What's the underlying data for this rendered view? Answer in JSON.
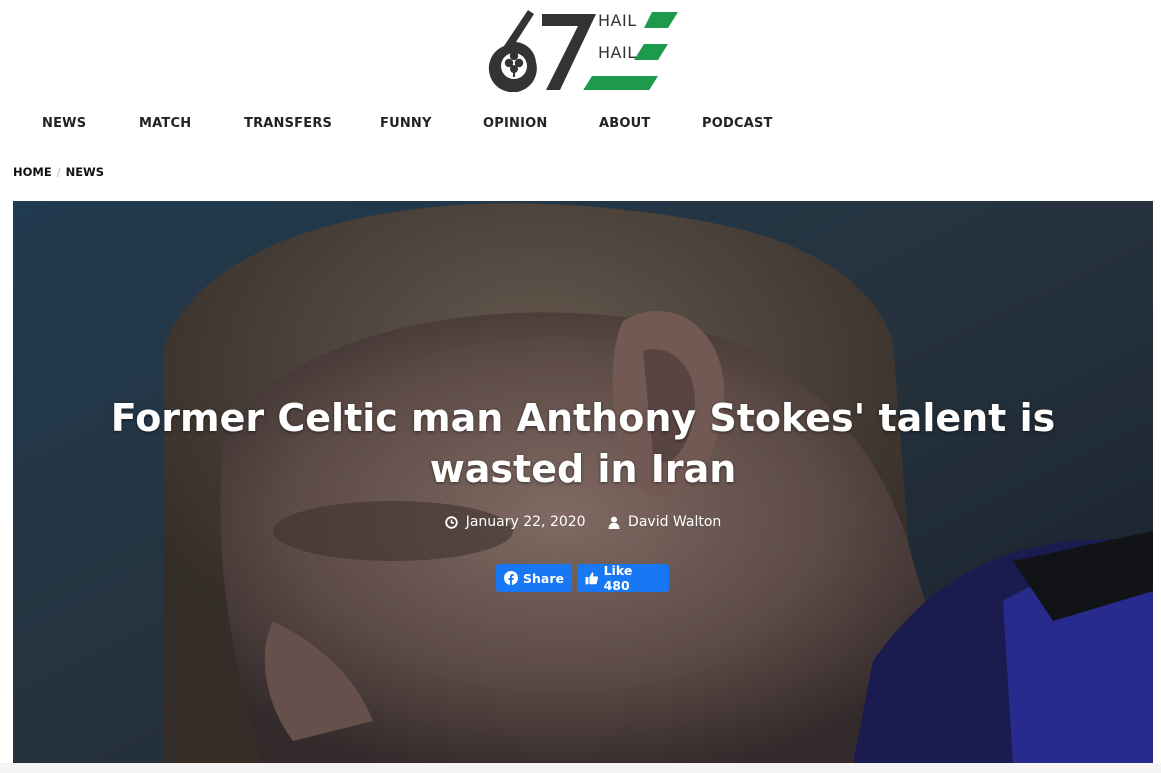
{
  "brand": {
    "logo_number": "67",
    "logo_word_1": "HAIL",
    "logo_word_2": "HAIL",
    "primary_color": "#333333",
    "accent_color": "#1e9a4d"
  },
  "nav": {
    "items": [
      {
        "label": "NEWS"
      },
      {
        "label": "MATCH"
      },
      {
        "label": "TRANSFERS"
      },
      {
        "label": "FUNNY"
      },
      {
        "label": "OPINION"
      },
      {
        "label": "ABOUT"
      },
      {
        "label": "PODCAST"
      }
    ]
  },
  "breadcrumb": {
    "home": "HOME",
    "separator": "/",
    "current": "NEWS"
  },
  "article": {
    "title_line_1": "Former Celtic man Anthony Stokes' talent is",
    "title_line_2": "wasted in Iran",
    "date": "January 22, 2020",
    "author": "David Walton",
    "date_icon": "clock-icon",
    "author_icon": "user-icon"
  },
  "social": {
    "share_label": "Share",
    "like_label": "Like 480",
    "button_color": "#1877f2"
  }
}
